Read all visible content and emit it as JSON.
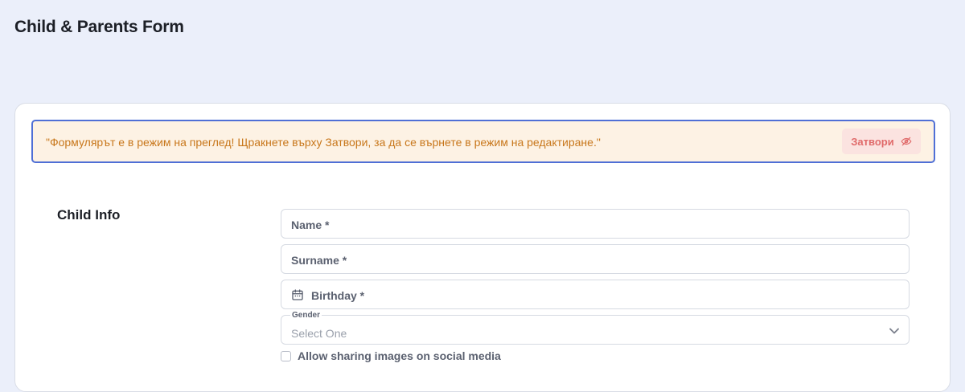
{
  "page": {
    "title": "Child & Parents Form"
  },
  "notice": {
    "message": "\"Формулярът е в режим на преглед! Щракнете върху Затвори, за да се върнете в режим на редактиране.\"",
    "close_label": "Затвори",
    "close_icon": "eye-off-icon"
  },
  "child_info": {
    "title": "Child Info",
    "name_label": "Name *",
    "surname_label": "Surname *",
    "birthday_label": "Birthday *",
    "birthday_icon": "calendar-icon",
    "gender_label": "Gender",
    "gender_value": "Select One",
    "gender_icon": "chevron-down-icon",
    "sharing_label": "Allow sharing images on social media",
    "sharing_checked": false
  },
  "colors": {
    "background": "#ebeffa",
    "notice_bg": "#fdf2e4",
    "notice_border": "#4f6fd6",
    "notice_text": "#c8771b",
    "close_bg": "#fbe3e0",
    "close_text": "#e06a6a"
  }
}
